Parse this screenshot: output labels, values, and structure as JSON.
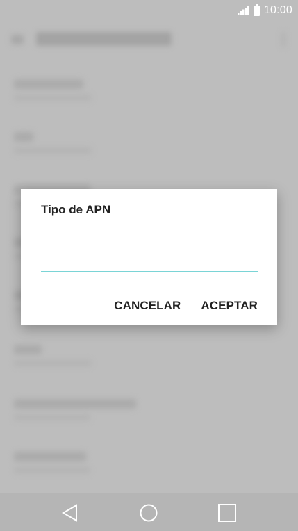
{
  "status_bar": {
    "time": "10:00",
    "signal_icon": "signal-icon",
    "battery_icon": "battery-icon"
  },
  "dialog": {
    "title": "Tipo de APN",
    "input": {
      "value": "",
      "placeholder": ""
    },
    "cancel_label": "CANCELAR",
    "accept_label": "ACEPTAR",
    "accent_color": "#7ad4d6"
  },
  "nav_bar": {
    "back_icon": "back-triangle-icon",
    "home_icon": "home-circle-icon",
    "recent_icon": "recent-square-icon"
  }
}
